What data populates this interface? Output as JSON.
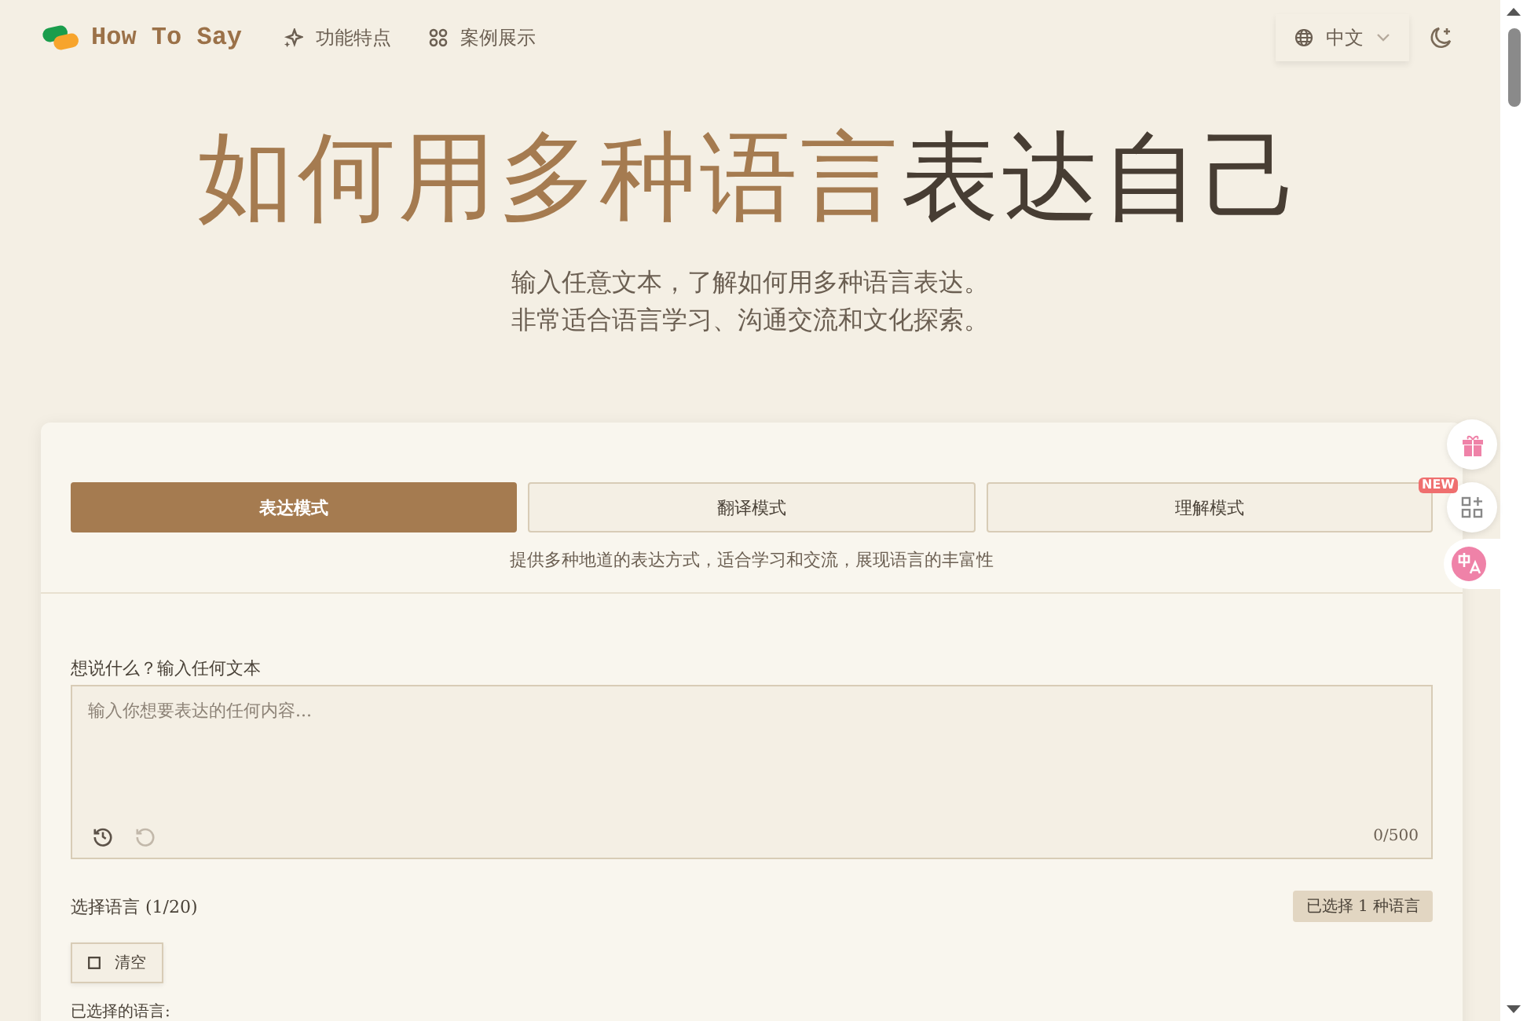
{
  "header": {
    "logo_text": "How To Say",
    "nav": [
      {
        "label": "功能特点",
        "kind": "sparkle"
      },
      {
        "label": "案例展示",
        "kind": "grid"
      }
    ],
    "language": {
      "label": "中文"
    }
  },
  "hero": {
    "title_accent": "如何用多种语言",
    "title_rest": "表达自己",
    "subtitle_lines": [
      "输入任意文本，了解如何用多种语言表达。",
      "非常适合语言学习、沟通交流和文化探索。"
    ]
  },
  "modes": [
    {
      "label": "表达模式",
      "selected": true
    },
    {
      "label": "翻译模式",
      "selected": false
    },
    {
      "label": "理解模式",
      "selected": false
    }
  ],
  "mode_description": "提供多种地道的表达方式，适合学习和交流，展现语言的丰富性",
  "input": {
    "label": "想说什么？输入任何文本",
    "placeholder": "输入你想要表达的任何内容...",
    "counter": "0/500"
  },
  "languages": {
    "label": "选择语言 (1/20)",
    "selected_count": "已选择 1 种语言",
    "clear_button": "清空",
    "selected_label": "已选择的语言:"
  },
  "floating": {
    "badge": "NEW"
  }
}
